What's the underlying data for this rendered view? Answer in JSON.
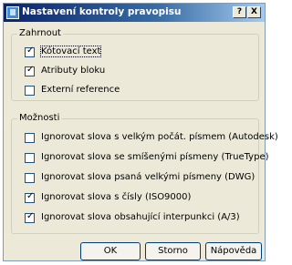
{
  "window": {
    "title": "Nastavení kontroly pravopisu",
    "help_label": "?",
    "close_label": "X"
  },
  "include": {
    "label": "Zahrnout",
    "items": [
      {
        "label": "Kótovací text",
        "checked": true
      },
      {
        "label": "Atributy bloku",
        "checked": true
      },
      {
        "label": "Externí reference",
        "checked": false
      }
    ]
  },
  "options": {
    "label": "Možnosti",
    "items": [
      {
        "label": "Ignorovat slova s velkým počát. písmem (Autodesk)",
        "checked": false
      },
      {
        "label": "Ignorovat slova se smíšenými písmeny (TrueType)",
        "checked": false
      },
      {
        "label": "Ignorovat slova psaná velkými písmeny (DWG)",
        "checked": false
      },
      {
        "label": "Ignorovat slova s čísly (ISO9000)",
        "checked": true
      },
      {
        "label": "Ignorovat slova obsahující interpunkci (A/3)",
        "checked": true
      }
    ]
  },
  "buttons": {
    "ok": "OK",
    "cancel": "Storno",
    "help": "Nápověda"
  },
  "check_glyph": "✓",
  "colors": {
    "dialog_bg": "#ece9d8",
    "titlebar_start": "#0a246a",
    "titlebar_end": "#a6caf0"
  }
}
